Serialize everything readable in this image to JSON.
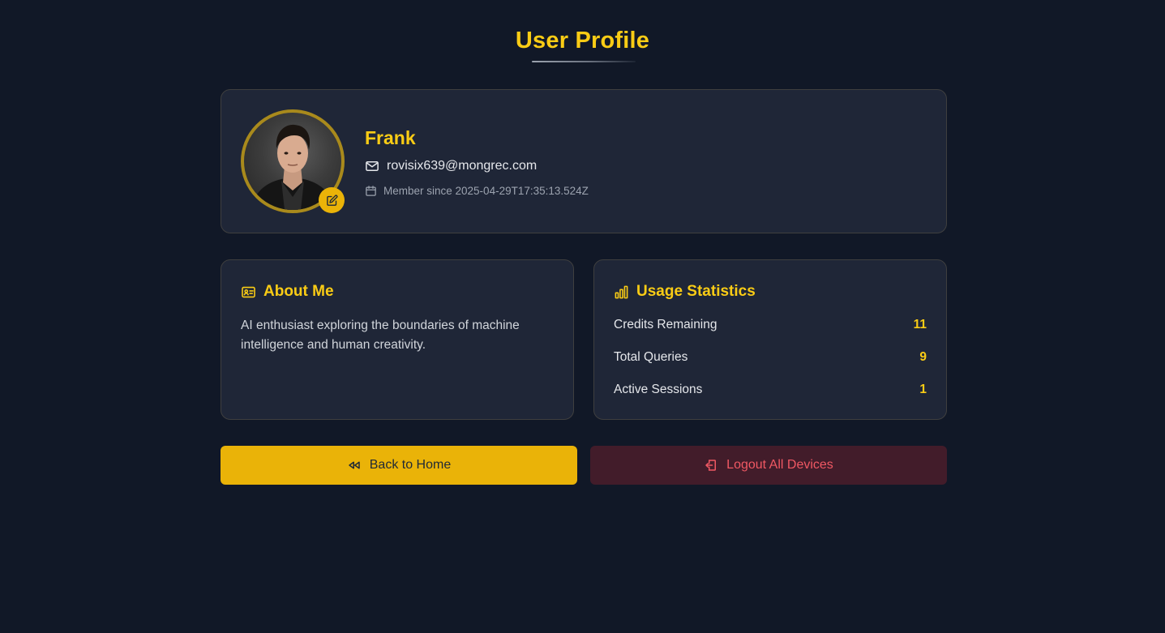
{
  "page": {
    "title": "User Profile"
  },
  "profile": {
    "name": "Frank",
    "email": "rovisix639@mongrec.com",
    "member_since": "Member since 2025-04-29T17:35:13.524Z"
  },
  "about": {
    "heading": "About Me",
    "text": "AI enthusiast exploring the boundaries of machine intelligence and human creativity."
  },
  "stats": {
    "heading": "Usage Statistics",
    "items": [
      {
        "label": "Credits Remaining",
        "value": "11"
      },
      {
        "label": "Total Queries",
        "value": "9"
      },
      {
        "label": "Active Sessions",
        "value": "1"
      }
    ]
  },
  "actions": {
    "back_label": "Back to Home",
    "logout_label": "Logout All Devices"
  },
  "colors": {
    "background": "#111827",
    "card": "#1f2637",
    "accent": "#facc15",
    "button_primary": "#eab308",
    "danger_bg": "#421c2a",
    "danger_text": "#f05863"
  },
  "icons": {
    "edit": "pencil-square-icon",
    "email": "envelope-icon",
    "member": "calendar-icon",
    "about": "id-card-icon",
    "stats": "bar-chart-icon",
    "back": "rewind-icon",
    "logout": "logout-door-icon"
  }
}
